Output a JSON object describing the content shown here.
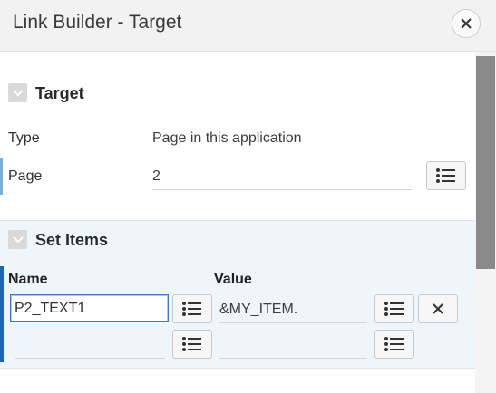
{
  "dialog": {
    "title": "Link Builder - Target"
  },
  "target_region": {
    "title": "Target",
    "type_label": "Type",
    "type_value": "Page in this application",
    "page_label": "Page",
    "page_value": "2"
  },
  "set_items_region": {
    "title": "Set Items",
    "name_header": "Name",
    "value_header": "Value",
    "rows": [
      {
        "name": "P2_TEXT1",
        "value": "&MY_ITEM."
      },
      {
        "name": "",
        "value": ""
      }
    ]
  },
  "icons": {
    "close": "close-icon",
    "list": "list-icon",
    "collapse": "chevron-down-icon",
    "remove": "x-icon"
  }
}
